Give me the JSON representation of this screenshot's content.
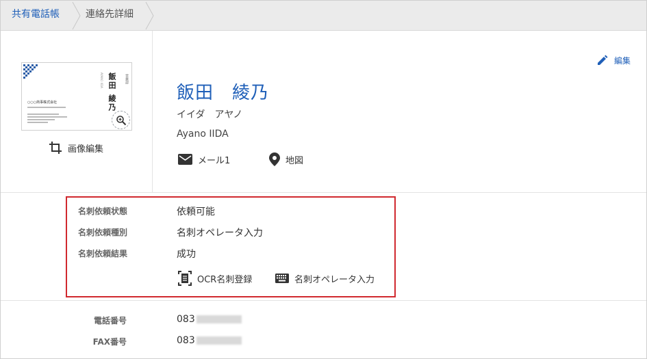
{
  "breadcrumb": {
    "root": "共有電話帳",
    "current": "連絡先詳細"
  },
  "card_image": {
    "position": "営業部",
    "name": "飯田 綾乃",
    "kana": "AYANO IIDA",
    "company": "○○○商事株式会社",
    "zoom_icon": "zoom-in-icon"
  },
  "image_edit": {
    "icon": "crop-icon",
    "label": "画像編集"
  },
  "edit": {
    "icon": "pencil-icon",
    "label": "編集"
  },
  "contact": {
    "name": "飯田　綾乃",
    "kana": "イイダ　アヤノ",
    "roman": "Ayano IIDA",
    "email_label": "メール1",
    "map_label": "地図"
  },
  "request": {
    "status_label": "名刺依頼状態",
    "status_value": "依頼可能",
    "type_label": "名刺依頼種別",
    "type_value": "名刺オペレータ入力",
    "result_label": "名刺依頼結果",
    "result_value": "成功",
    "ocr_button": "OCR名刺登録",
    "operator_button": "名刺オペレータ入力"
  },
  "phones": {
    "tel_label": "電話番号",
    "tel_value": "083",
    "fax_label": "FAX番号",
    "fax_value": "083"
  },
  "colors": {
    "accent": "#1f5fb8",
    "highlight": "#d0282e",
    "breadcrumb_bg": "#ebebeb"
  }
}
